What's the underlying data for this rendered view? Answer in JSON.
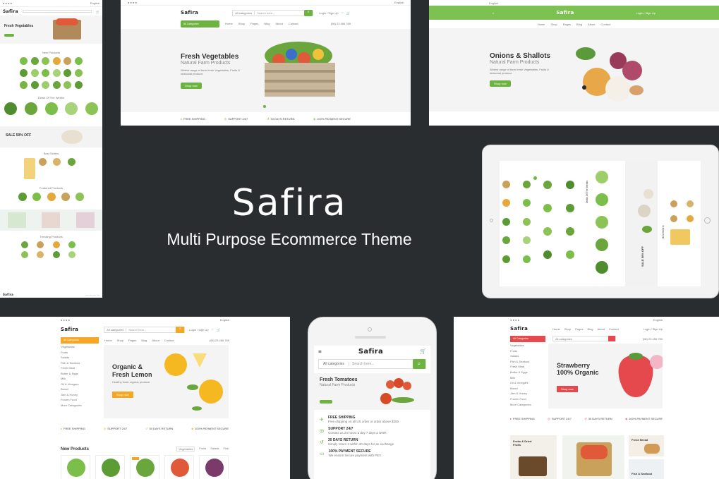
{
  "center": {
    "brand": "Safira",
    "tagline": "Multi Purpose Ecommerce Theme"
  },
  "common": {
    "language": "English",
    "currency": "$USD",
    "all_categories": "All Categories",
    "login": "Login / Sign Up",
    "phone": "(08) 23 456 789",
    "nav": [
      "Home",
      "Shop",
      "Pages",
      "Blog",
      "About",
      "Contact"
    ],
    "shop_now": "Shop now",
    "hero_desc": "Widest range of farm fresh Vegetables, Fruits & seasonal produce"
  },
  "left_panel": {
    "hero_title": "Fresh Vegetables",
    "section_new": "New Products",
    "section_deal": "Deals Of The Weeks",
    "sale_banner": "SALE 50% OFF",
    "section_best": "Best Sellers",
    "section_featured": "Featured Products",
    "section_trending": "Trending Products"
  },
  "top1": {
    "search_placeholder": "Search here...",
    "categories_select": "All categories",
    "hero_title": "Fresh Vegetables",
    "hero_subtitle": "Natural Farm Products",
    "features": [
      "FREE SHIPPING",
      "SUPPORT 24/7",
      "30 DAYS RETURN",
      "100% PAYMENT SECURE"
    ]
  },
  "top2": {
    "hero_title": "Onions & Shallots",
    "hero_subtitle": "Natural Farm Products"
  },
  "ipad": {
    "side_label": "Deals Of The Weeks",
    "sale_label": "SALE 50% OFF",
    "best_label": "Best Sellers"
  },
  "bottom1": {
    "hero_title_1": "Organic &",
    "hero_title_2": "Fresh Lemon",
    "hero_desc": "Healthy fresh organic produce",
    "categories": [
      "Vegetables",
      "Fruits",
      "Salads",
      "Fish & Seafood",
      "Fresh Meat",
      "Butter & Eggs",
      "Milk",
      "Oil & Vinegars",
      "Bread",
      "Jam & Honey",
      "Frozen Food",
      "More Categories"
    ],
    "features": [
      "FREE SHIPPING",
      "SUPPORT 24/7",
      "30 DAYS RETURN",
      "100% PAYMENT SECURE"
    ],
    "new_products": "New Products",
    "product_tabs": [
      "Vegetables",
      "Fruits",
      "Salads",
      "Fish"
    ]
  },
  "phone": {
    "brand": "Safira",
    "categories_select": "All categories",
    "search_placeholder": "Search here...",
    "hero_title": "Fresh Tomatoes",
    "hero_subtitle": "Natural Farm Products",
    "features": [
      {
        "title": "FREE SHIPPING",
        "desc": "Free shipping on all US order or order above $200"
      },
      {
        "title": "SUPPORT 24/7",
        "desc": "Contact us 24 hours a day 7 days a week"
      },
      {
        "title": "30 DAYS RETURN",
        "desc": "Simply return it within 30 days for an exchange"
      },
      {
        "title": "100% PAYMENT SECURE",
        "desc": "We ensure secure payment with PEV"
      }
    ]
  },
  "bottom2": {
    "hero_title_1": "Strawberry",
    "hero_title_2": "100% Organic",
    "categories": [
      "Vegetables",
      "Fruits",
      "Salads",
      "Fish & Seafood",
      "Fresh Meat",
      "Butter & Eggs",
      "Milk",
      "Oil & Vinegars",
      "Bread",
      "Jam & Honey",
      "Frozen Food",
      "More Categories"
    ],
    "features": [
      "FREE SHIPPING",
      "SUPPORT 24/7",
      "30 DAYS RETURN",
      "100% PAYMENT SECURE"
    ],
    "banner_1": "Fruits & Dried Fruits",
    "banner_2": "Fresh Bread",
    "banner_3": "Fish & Seafood"
  },
  "colors": {
    "accent_green": "#6db33f",
    "accent_orange": "#f5a623",
    "background": "#2a2d2f"
  }
}
